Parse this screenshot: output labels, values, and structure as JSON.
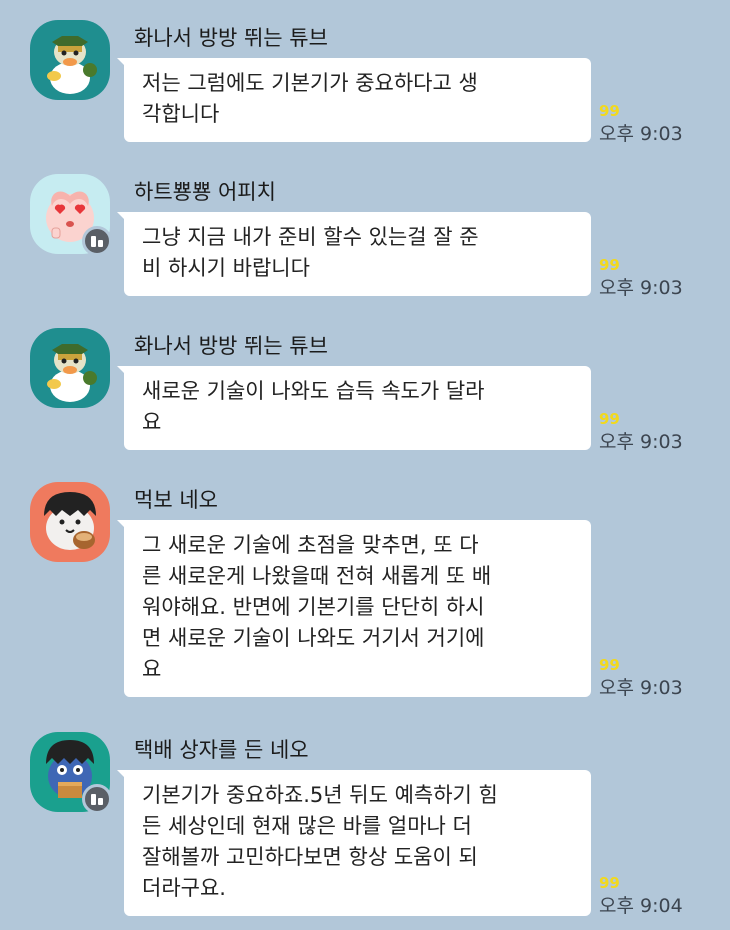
{
  "colors": {
    "background": "#b2c7d9",
    "bubble": "#ffffff",
    "unread": "#f2d91d"
  },
  "messages": [
    {
      "sender": "화나서 방방 뛰는 튜브",
      "avatar_icon": "angry-duck-avatar",
      "text": "저는 그럼에도 기본기가 중요하다고 생\n각합니다",
      "unread": "99",
      "time": "오후 9:03"
    },
    {
      "sender": "하트뿅뿅 어피치",
      "avatar_icon": "heart-eyes-peach-avatar",
      "text": "그냥 지금 내가 준비 할수 있는걸 잘 준\n비 하시기 바랍니다",
      "unread": "99",
      "time": "오후 9:03"
    },
    {
      "sender": "화나서 방방 뛰는 튜브",
      "avatar_icon": "angry-duck-avatar",
      "text": "새로운 기술이 나와도 습득 속도가 달라\n요",
      "unread": "99",
      "time": "오후 9:03"
    },
    {
      "sender": "먹보 네오",
      "avatar_icon": "eating-neo-cat-avatar",
      "text": "그 새로운 기술에 초점을 맞추면, 또 다\n른 새로운게 나왔을때 전혀 새롭게 또 배\n워야해요. 반면에 기본기를 단단히 하시\n면 새로운 기술이 나와도 거기서 거기에\n요",
      "unread": "99",
      "time": "오후 9:03"
    },
    {
      "sender": "택배 상자를 든 네오",
      "avatar_icon": "box-neo-cat-avatar",
      "text": "기본기가 중요하죠.5년 뒤도 예측하기 힘\n든 세상인데 현재 많은 바를 얼마나 더\n잘해볼까 고민하다보면 항상 도움이 되\n더라구요.",
      "unread": "99",
      "time": "오후 9:04"
    }
  ]
}
